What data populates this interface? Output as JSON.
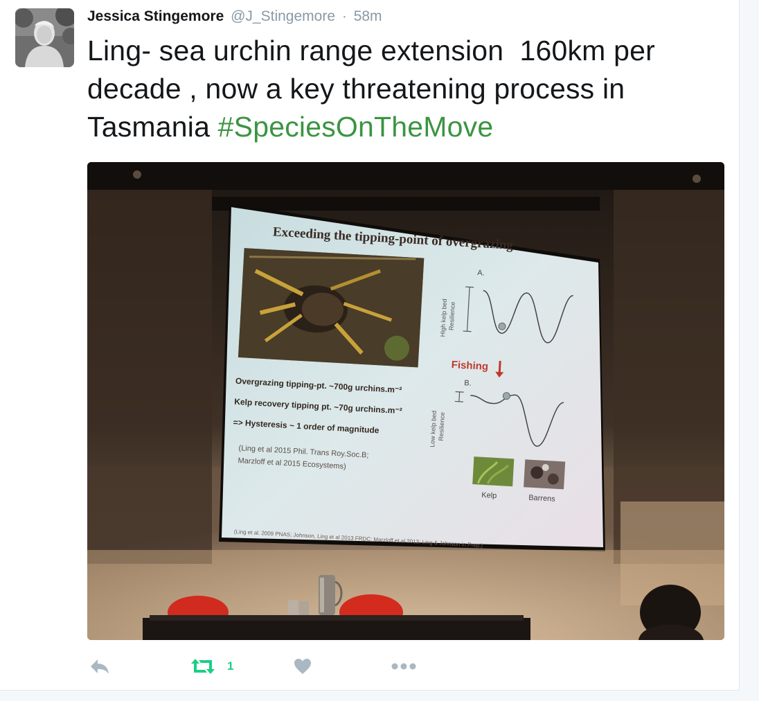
{
  "tweet": {
    "author": {
      "fullname": "Jessica Stingemore",
      "username": "@J_Stingemore",
      "separator": "·",
      "timestamp": "58m"
    },
    "text": "Ling- sea urchin range extension  160km per decade , now a key threatening process in Tasmania ",
    "hashtag": "#SpeciesOnTheMove",
    "actions": {
      "reply_icon": "reply-icon",
      "retweet_icon": "retweet-icon",
      "retweet_count": "1",
      "like_icon": "heart-icon",
      "more_icon": "more-dots-icon"
    },
    "colors": {
      "hashtag": "#3b9442",
      "retweet": "#19cf86",
      "muted": "#8899a6",
      "action_icon": "#aab8c2"
    }
  },
  "media": {
    "slide": {
      "title": "Exceeding the tipping-point of overgrazing",
      "line1": "Overgrazing tipping-pt. ~700g urchins.m⁻²",
      "line2": "Kelp recovery tipping pt. ~70g urchins.m⁻²",
      "line3": "=> Hysteresis ~ 1 order of magnitude",
      "cite1": "(Ling et al 2015 Phil. Trans Roy.Soc.B;",
      "cite2": "Marzloff et al 2015 Ecosystems)",
      "label_a": "A.",
      "label_b": "B.",
      "axis_top_1": "High kelp bed",
      "axis_top_2": "Resilience",
      "axis_bottom_1": "Low kelp bed",
      "axis_bottom_2": "Resilience",
      "fishing": "Fishing",
      "kelp": "Kelp",
      "barrens": "Barrens",
      "footer": "(Ling et al. 2009 PNAS; Johnson, Ling et al 2013 FRDC; Marzloff et al 2013; Ling & Johnson in Prep.)"
    }
  }
}
